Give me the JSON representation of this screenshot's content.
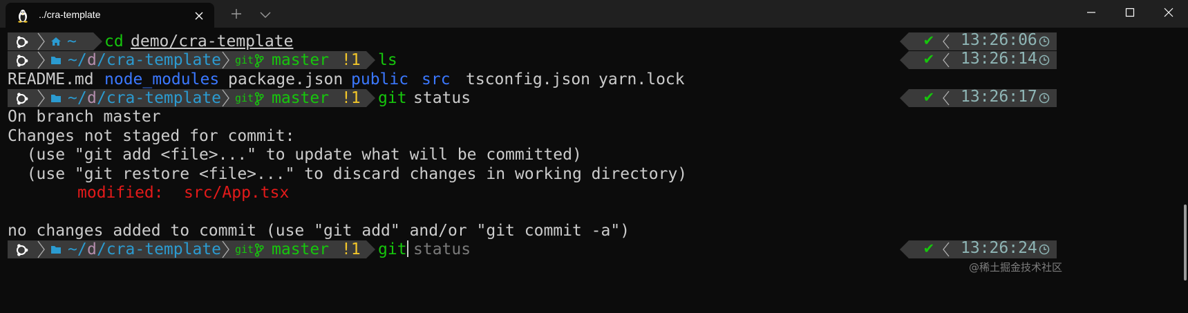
{
  "window": {
    "tab_title": "../cra-template",
    "tab_icon": "linux-penguin-icon",
    "buttons": [
      "minimize",
      "maximize",
      "close"
    ]
  },
  "prompt": {
    "home_symbol": "~",
    "path_prefix": "~/",
    "path_mid": "d",
    "path_tail": "/cra-template",
    "git_label": "git",
    "branch": "master",
    "branch_status": "!1"
  },
  "lines": [
    {
      "cmd": "cd",
      "arg": "demo/cra-template",
      "time": "13:26:06"
    },
    {
      "cmd": "ls",
      "time": "13:26:14"
    },
    {
      "cmd": "git",
      "arg": "status",
      "time": "13:26:17"
    },
    {
      "cmd": "git",
      "suggestion": "status",
      "time": "13:26:24"
    }
  ],
  "ls_output": {
    "files": [
      "README.md",
      "package.json",
      "tsconfig.json",
      "yarn.lock"
    ],
    "dirs": [
      "node_modules",
      "public",
      "src"
    ]
  },
  "status_output": {
    "line1": "On branch master",
    "line2": "Changes not staged for commit:",
    "line3": "  (use \"git add <file>...\" to update what will be committed)",
    "line4": "  (use \"git restore <file>...\" to discard changes in working directory)",
    "modified_label": "modified:",
    "modified_file": "src/App.tsx",
    "summary": "no changes added to commit (use \"git add\" and/or \"git commit -a\")"
  },
  "status_check": "✔",
  "watermark": "@稀土掘金技术社区",
  "colors": {
    "background": "#0c0c0c",
    "titlebar": "#202020",
    "prompt_bg": "#3a3a3a",
    "path": "#2b9bd1",
    "git_green": "#16c60c",
    "branch_status": "#f2c62a",
    "dir_blue": "#3b78ff",
    "modified_red": "#e31a1a"
  }
}
